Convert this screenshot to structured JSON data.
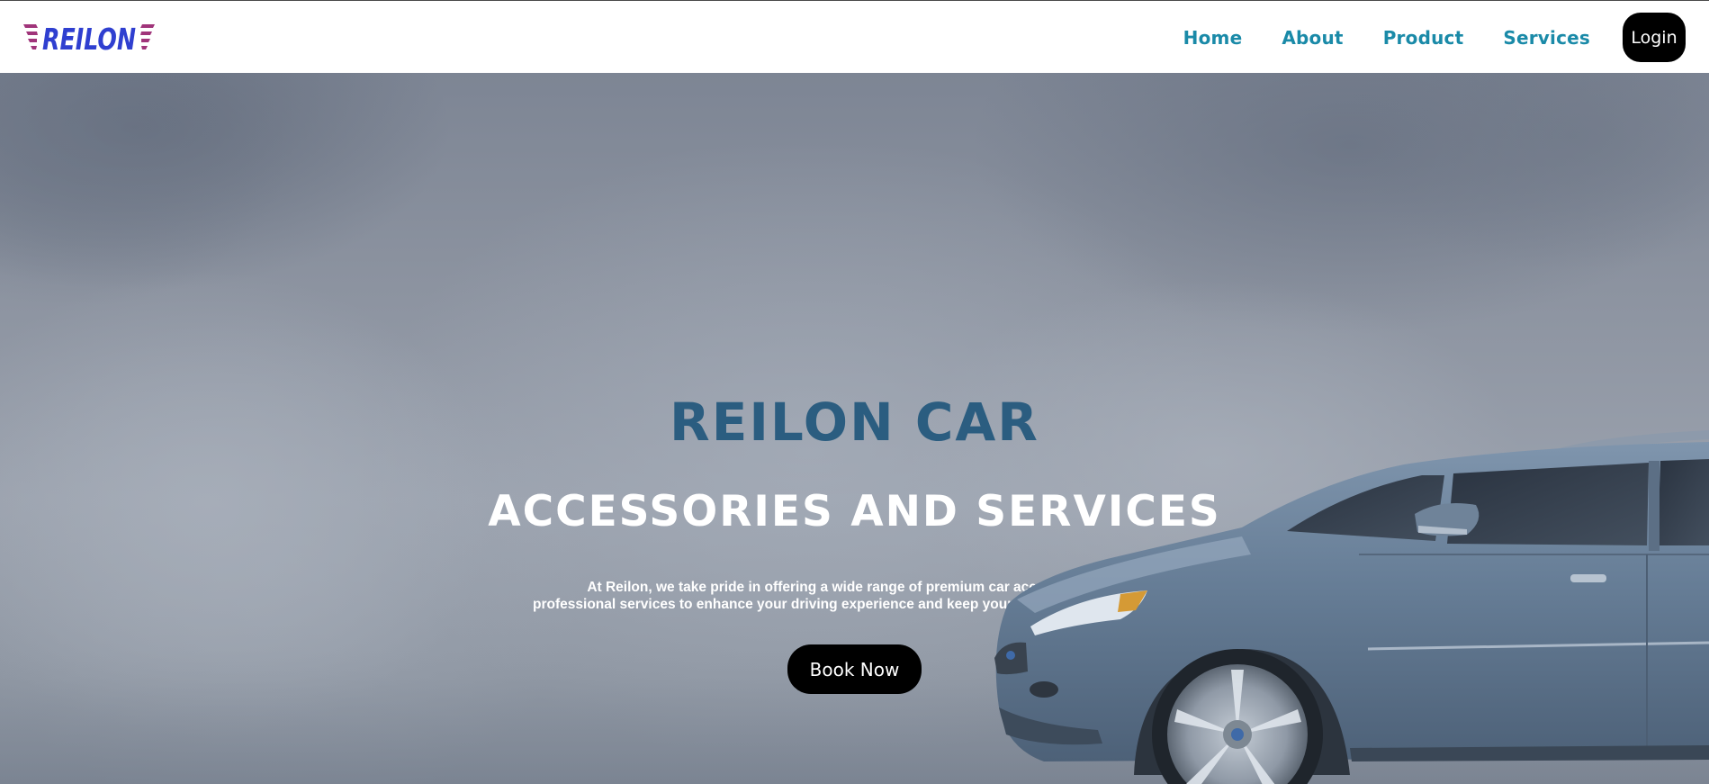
{
  "brand": {
    "logo_text": "REILON",
    "logo_colors": {
      "text": "#2f3fd0",
      "wings": "#a0347a"
    }
  },
  "nav": {
    "links": [
      {
        "label": "Home"
      },
      {
        "label": "About"
      },
      {
        "label": "Product"
      },
      {
        "label": "Services"
      }
    ],
    "login_label": "Login",
    "link_color": "#1a8aa8"
  },
  "hero": {
    "title": "REILON CAR",
    "subtitle": "ACCESSORIES AND SERVICES",
    "description_line1": "At Reilon, we take pride in offering a wide range of premium car accessories and",
    "description_line2": "professional services to enhance your driving experience and keep your vehicle in top condition.",
    "cta_label": "Book Now",
    "title_color": "#2b5d80",
    "background_image": "car-image"
  }
}
